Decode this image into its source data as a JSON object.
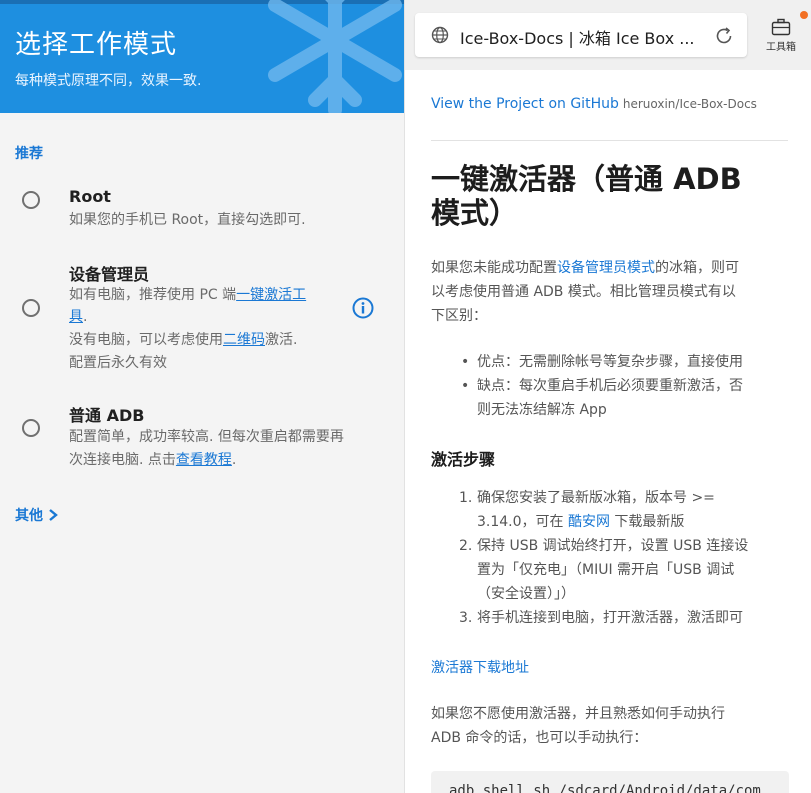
{
  "left": {
    "title": "选择工作模式",
    "subtitle": "每种模式原理不同，效果一致.",
    "section_recommended": "推荐",
    "options": [
      {
        "title": "Root",
        "lines": [
          "如果您的手机已 Root，直接勾选即可."
        ]
      },
      {
        "title": "设备管理员",
        "line1_pre": "如有电脑，推荐使用 PC 端",
        "line1_link": "一键激活工",
        "line2_link": "具",
        "line2_post": ".",
        "line3_pre": "没有电脑，可以考虑使用",
        "line3_link": "二维码",
        "line3_post": "激活.",
        "line4": "配置后永久有效"
      },
      {
        "title": "普通 ADB",
        "line1": "配置简单，成功率较高. 但每次重启都需要再",
        "line2_pre": "次连接电脑. 点击",
        "line2_link": "查看教程",
        "line2_post": "."
      }
    ],
    "other_label": "其他",
    "colors": {
      "header": "#1e8fe0",
      "accent": "#1a78d4"
    }
  },
  "browser": {
    "tab_title": "Ice-Box-Docs | 冰箱 Ice Box ...",
    "toolbox_label": "工具箱"
  },
  "doc": {
    "github_link": "View the Project on GitHub",
    "github_repo": "heruoxin/Ice-Box-Docs",
    "heading_line1": "一键激活器（普通 ADB",
    "heading_line2": "模式）",
    "intro_l1_pre": "如果您未能成功配置",
    "intro_l1_link": "设备管理员模式",
    "intro_l1_post": "的冰箱，则可",
    "intro_l2": "以考虑使用普通 ADB 模式。相比管理员模式有以",
    "intro_l3": "下区别：",
    "bullets": [
      "优点：无需删除帐号等复杂步骤，直接使用",
      "缺点：每次重启手机后必须要重新激活，否",
      "则无法冻结解冻 App"
    ],
    "steps_heading": "激活步骤",
    "steps": [
      {
        "num": "1.",
        "l1": "确保您安装了最新版冰箱，版本号 >=",
        "l2_pre": "3.14.0，可在 ",
        "l2_link": "酷安网",
        "l2_post": " 下载最新版"
      },
      {
        "num": "2.",
        "l1": "保持 USB 调试始终打开，设置 USB 连接设",
        "l2": "置为「仅充电」（MIUI 需开启「USB 调试",
        "l3": "（安全设置）」）"
      },
      {
        "num": "3.",
        "l1": "将手机连接到电脑，打开激活器，激活即可"
      }
    ],
    "download_link": "激活器下载地址",
    "manual_l1": "如果您不愿使用激活器，并且熟悉如何手动执行",
    "manual_l2": "ADB 命令的话，也可以手动执行：",
    "code": "adb shell sh /sdcard/Android/data/com"
  }
}
